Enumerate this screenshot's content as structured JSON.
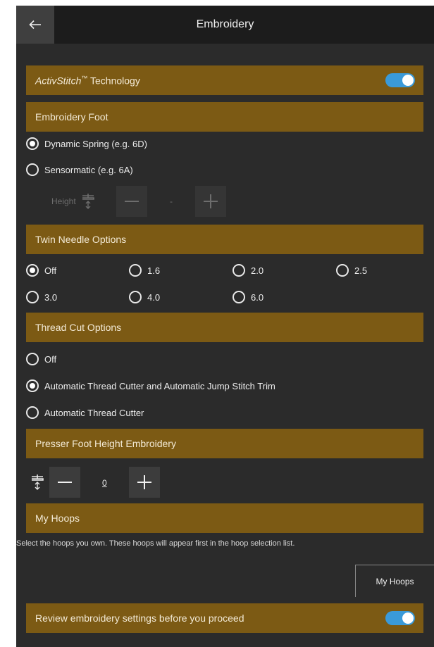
{
  "header": {
    "title": "Embroidery",
    "back_icon": "arrow-left-icon"
  },
  "activstitch": {
    "label_italic": "ActivStitch",
    "label_tm": "™",
    "label_rest": " Technology",
    "enabled": true
  },
  "embroidery_foot": {
    "title": "Embroidery Foot",
    "options": [
      {
        "label": "Dynamic Spring (e.g. 6D)",
        "selected": true
      },
      {
        "label": "Sensormatic (e.g. 6A)",
        "selected": false
      }
    ],
    "height_label": "Height",
    "height_value": "-"
  },
  "twin_needle": {
    "title": "Twin Needle Options",
    "options": [
      {
        "label": "Off",
        "selected": true
      },
      {
        "label": "1.6",
        "selected": false
      },
      {
        "label": "2.0",
        "selected": false
      },
      {
        "label": "2.5",
        "selected": false
      },
      {
        "label": "3.0",
        "selected": false
      },
      {
        "label": "4.0",
        "selected": false
      },
      {
        "label": "6.0",
        "selected": false
      }
    ]
  },
  "thread_cut": {
    "title": "Thread Cut Options",
    "options": [
      {
        "label": "Off",
        "selected": false
      },
      {
        "label": "Automatic Thread Cutter and Automatic Jump Stitch Trim",
        "selected": true
      },
      {
        "label": "Automatic Thread Cutter",
        "selected": false
      }
    ]
  },
  "presser_foot": {
    "title": "Presser Foot Height Embroidery",
    "value": "0"
  },
  "my_hoops": {
    "title": "My Hoops",
    "description": "Select the hoops you own. These hoops will appear first in the hoop selection list.",
    "button_label": "My Hoops"
  },
  "review": {
    "label": "Review embroidery settings before you proceed",
    "enabled": true
  },
  "colors": {
    "section_bg": "#7c5a14",
    "toggle_on": "#3a9ad9",
    "app_bg": "#2b2b2b"
  }
}
